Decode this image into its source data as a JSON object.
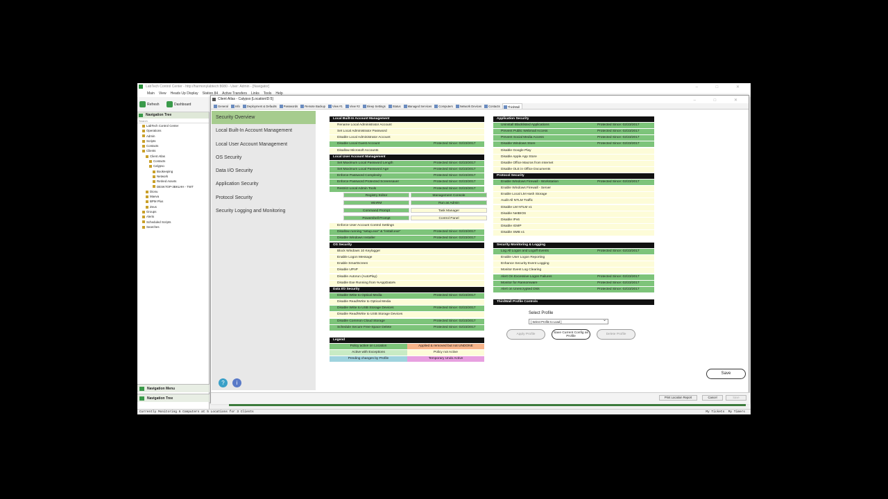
{
  "app": {
    "title": "LabTech Control Center - http://harmonylabtech:8080 - User: Admin - [Navigator]",
    "menu": [
      "Main",
      "View",
      "Heads Up Display",
      "Station 84",
      "Active Transfers",
      "Links",
      "Tools",
      "Help"
    ],
    "toolbar": {
      "refresh": "Refresh",
      "dashboard": "Dashboard"
    }
  },
  "nav": {
    "header": "Navigation Tree",
    "search": "Search",
    "tree": [
      "LabTech Control Center",
      "Operations",
      "Admin",
      "Scripts",
      "Contacts",
      "Clients",
      "Client Atlas",
      "Contacts",
      "Calypso",
      "Bookeeping",
      "Network",
      "Retired Assets",
      "DESKTOP-3BKLHH - TWT",
      "Dionu",
      "Maeva",
      "BPM Plus",
      "Zeus",
      "Groups",
      "Alerts",
      "Scheduled Scripts",
      "Searches"
    ],
    "menu_label": "Navigation Menu",
    "tree_label": "Navigation Tree"
  },
  "status": {
    "left": "Currently Monitoring 6 Computers at 5 Locations for 3 Clients",
    "tickets": "My Tickets",
    "timers": "My Timers"
  },
  "client": {
    "title": "Client Atlas - Calypso  [LocationID:5]",
    "tabs": [
      "General",
      "Info",
      "Deployment & Defaults",
      "Passwords",
      "Remote Backup",
      "View #1",
      "View #2",
      "Sleep Settings",
      "Status",
      "Managed Services",
      "Computers",
      "Network Devices",
      "Contacts",
      "ThirdWall"
    ],
    "side": [
      "Security Overview",
      "Local Built-In Account Management",
      "Local User Account Management",
      "OS Security",
      "Data I/O Security",
      "Application Security",
      "Protocol Security",
      "Security Logging and Monitoring"
    ],
    "footer": {
      "print": "Print Location Report",
      "cancel": "Cancel",
      "save": "Save"
    },
    "save": "Save"
  },
  "protected": "Protected Since: 02/23/2017",
  "sections": {
    "local_builtin": {
      "title": "Local Built-In Account Management",
      "rows": [
        [
          "Rename Local Administrator Account",
          "y"
        ],
        [
          "Set Local Administrator Password",
          "y"
        ],
        [
          "Disable Local Administrator Account",
          "y"
        ],
        [
          "Disable Local Guest Account",
          "g"
        ],
        [
          "Disallow Microsoft Accounts",
          "y"
        ]
      ]
    },
    "local_user": {
      "title": "Local User Account Management",
      "rows": [
        [
          "Set Maximum Local Password Length",
          "g"
        ],
        [
          "Set Maximum Local Password Age",
          "g"
        ],
        [
          "Enforce Password Complexity",
          "g"
        ],
        [
          "Enforce Password Protected Screensaver",
          "g"
        ],
        [
          "Restrict Local Admin Tools",
          "g"
        ]
      ],
      "grid": [
        [
          "Registry Editor",
          "g",
          "Management Console",
          "g"
        ],
        [
          "WinRM",
          "g",
          "Run as Admin",
          "g"
        ],
        [
          "Command Prompt",
          "g",
          "Task Manager",
          "y"
        ],
        [
          "Powershell Prompt",
          "g",
          "Control Panel",
          "y"
        ]
      ],
      "rows2": [
        [
          "Enforce User Account Control Settings",
          "y"
        ],
        [
          "Disallow running \"setup.exe\" & \"install.exe\"",
          "g"
        ],
        [
          "Disable Windows Installer",
          "g"
        ]
      ]
    },
    "os": {
      "title": "OS Security",
      "rows": [
        [
          "Block Windows 10 Keylogger",
          "y"
        ],
        [
          "Enable Logon Message",
          "y"
        ],
        [
          "Enable SmartScreen",
          "y"
        ],
        [
          "Disable UPnP",
          "y"
        ],
        [
          "Disable Autorun (AutoPlay)",
          "y"
        ],
        [
          "Disable Exe Running from %AppData%",
          "y"
        ]
      ]
    },
    "dataio": {
      "title": "Data I/O Security",
      "rows": [
        [
          "Disable Write to Optical Media",
          "g"
        ],
        [
          "Disable Read/Write to Optical Media",
          "y"
        ],
        [
          "Disable Write to USB Storage Devices",
          "g"
        ],
        [
          "Disable Read/Write to USB Storage Devices",
          "y"
        ],
        [
          "Disable Common Cloud Storage",
          "g"
        ],
        [
          "Schedule Secure Free-Space Delete",
          "g"
        ]
      ]
    },
    "legend": {
      "title": "Legend",
      "items": [
        [
          "Policy active on Location",
          "#7dc47a",
          "Applied & removed but not UNDONE",
          "#f7b48a"
        ],
        [
          "Active with Exceptions",
          "#c8ebc4",
          "Policy not Active",
          "#fdfcd8"
        ],
        [
          "Pending changes by Profile",
          "#9fd3de",
          "Temporary Undo Active",
          "#e8a0e0"
        ]
      ]
    },
    "app": {
      "title": "Application Security",
      "rows": [
        [
          "Uninstall Blacklisted Applications",
          "g"
        ],
        [
          "Prevent Public Webmail Access",
          "g"
        ],
        [
          "Prevent Social Media Access",
          "g"
        ],
        [
          "Disable Windows Store",
          "g"
        ],
        [
          "Disable Google Play",
          "y"
        ],
        [
          "Disable Apple App Store",
          "y"
        ],
        [
          "Disable Office Macros from Internet",
          "y"
        ],
        [
          "Disable OLE in Office Documents",
          "y"
        ]
      ]
    },
    "protocol": {
      "title": "Protocol Security",
      "rows": [
        [
          "Enable Windows Firewall - Workstation",
          "g"
        ],
        [
          "Enable Windows Firewall - Server",
          "y"
        ],
        [
          "Enable Local LM Hash Storage",
          "y"
        ],
        [
          "Audit All NTLM Traffic",
          "y"
        ],
        [
          "Disable LM NTLM v1",
          "y"
        ],
        [
          "Disable NetBIOS",
          "y"
        ],
        [
          "Disable IPv6",
          "y"
        ],
        [
          "Disable IGMP",
          "y"
        ],
        [
          "Disable SMB v1",
          "y"
        ]
      ]
    },
    "logging": {
      "title": "Security Monitoring & Logging",
      "rows": [
        [
          "Log All Logon and Logoff Events",
          "g"
        ],
        [
          "Enable User Logon Reporting",
          "y"
        ],
        [
          "Enhance Security Event Logging",
          "y"
        ],
        [
          "Monitor Event Log Clearing",
          "y"
        ],
        [
          "Alert On Excessive Logon Failures",
          "g"
        ],
        [
          "Monitor for Ransomware",
          "g"
        ],
        [
          "Alert on Unencrypted Disk",
          "g"
        ]
      ]
    },
    "profile": {
      "title": "ThirdWall Profile Controls",
      "label": "Select Profile",
      "placeholder": "[ Select Profile to Load ]",
      "apply": "Apply Profile",
      "save_current": "Save Current Config as Profile",
      "delete": "Delete Profile"
    }
  }
}
